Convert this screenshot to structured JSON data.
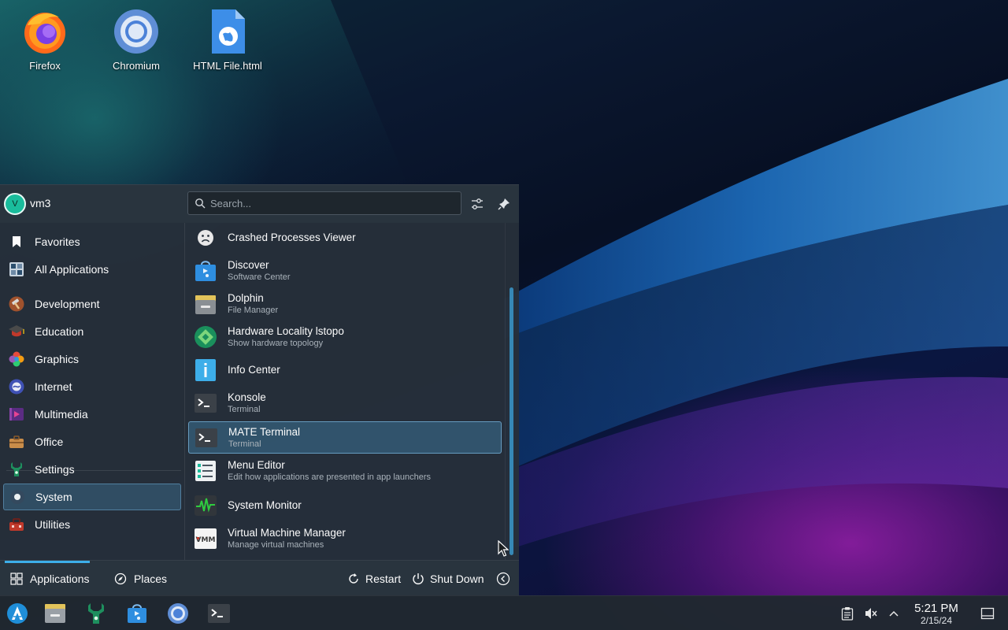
{
  "desktop": {
    "icons": [
      {
        "label": "Firefox",
        "icon": "firefox-icon"
      },
      {
        "label": "Chromium",
        "icon": "chromium-icon"
      },
      {
        "label": "HTML File.html",
        "icon": "html-file-icon"
      }
    ]
  },
  "launcher": {
    "user": {
      "name": "vm3",
      "avatar_letter": "V"
    },
    "search": {
      "placeholder": "Search..."
    },
    "categories": [
      {
        "label": "Favorites",
        "icon": "bookmark-icon"
      },
      {
        "label": "All Applications",
        "icon": "all-apps-icon"
      },
      {
        "label": "Development",
        "icon": "hammer-icon"
      },
      {
        "label": "Education",
        "icon": "graduation-cap-icon"
      },
      {
        "label": "Graphics",
        "icon": "graphics-icon"
      },
      {
        "label": "Internet",
        "icon": "internet-icon"
      },
      {
        "label": "Multimedia",
        "icon": "multimedia-icon"
      },
      {
        "label": "Office",
        "icon": "briefcase-icon"
      },
      {
        "label": "Settings",
        "icon": "settings-wrench-icon"
      },
      {
        "label": "System",
        "icon": "system-icon",
        "selected": true
      },
      {
        "label": "Utilities",
        "icon": "toolbox-icon"
      }
    ],
    "apps": [
      {
        "name": "Crashed Processes Viewer",
        "desc": "",
        "icon": "sad-face-icon"
      },
      {
        "name": "Discover",
        "desc": "Software Center",
        "icon": "discover-icon"
      },
      {
        "name": "Dolphin",
        "desc": "File Manager",
        "icon": "folder-icon"
      },
      {
        "name": "Hardware Locality lstopo",
        "desc": "Show hardware topology",
        "icon": "hardware-icon"
      },
      {
        "name": "Info Center",
        "desc": "",
        "icon": "info-icon"
      },
      {
        "name": "Konsole",
        "desc": "Terminal",
        "icon": "terminal-icon"
      },
      {
        "name": "MATE Terminal",
        "desc": "Terminal",
        "icon": "terminal-icon",
        "selected": true
      },
      {
        "name": "Menu Editor",
        "desc": "Edit how applications are presented in app launchers",
        "icon": "menu-editor-icon"
      },
      {
        "name": "System Monitor",
        "desc": "",
        "icon": "system-monitor-icon"
      },
      {
        "name": "Virtual Machine Manager",
        "desc": "Manage virtual machines",
        "icon": "vmm-icon"
      }
    ],
    "footer": {
      "tab_applications": "Applications",
      "tab_places": "Places",
      "restart": "Restart",
      "shutdown": "Shut Down"
    }
  },
  "taskbar": {
    "pinned": [
      "application-launcher-icon",
      "dolphin-icon",
      "settings-wrench-icon",
      "discover-icon",
      "chromium-icon",
      "terminal-icon"
    ],
    "clock": {
      "time": "5:21 PM",
      "date": "2/15/24"
    }
  },
  "colors": {
    "accent": "#3daee9",
    "panel": "#26303a",
    "taskbar": "#202830"
  }
}
